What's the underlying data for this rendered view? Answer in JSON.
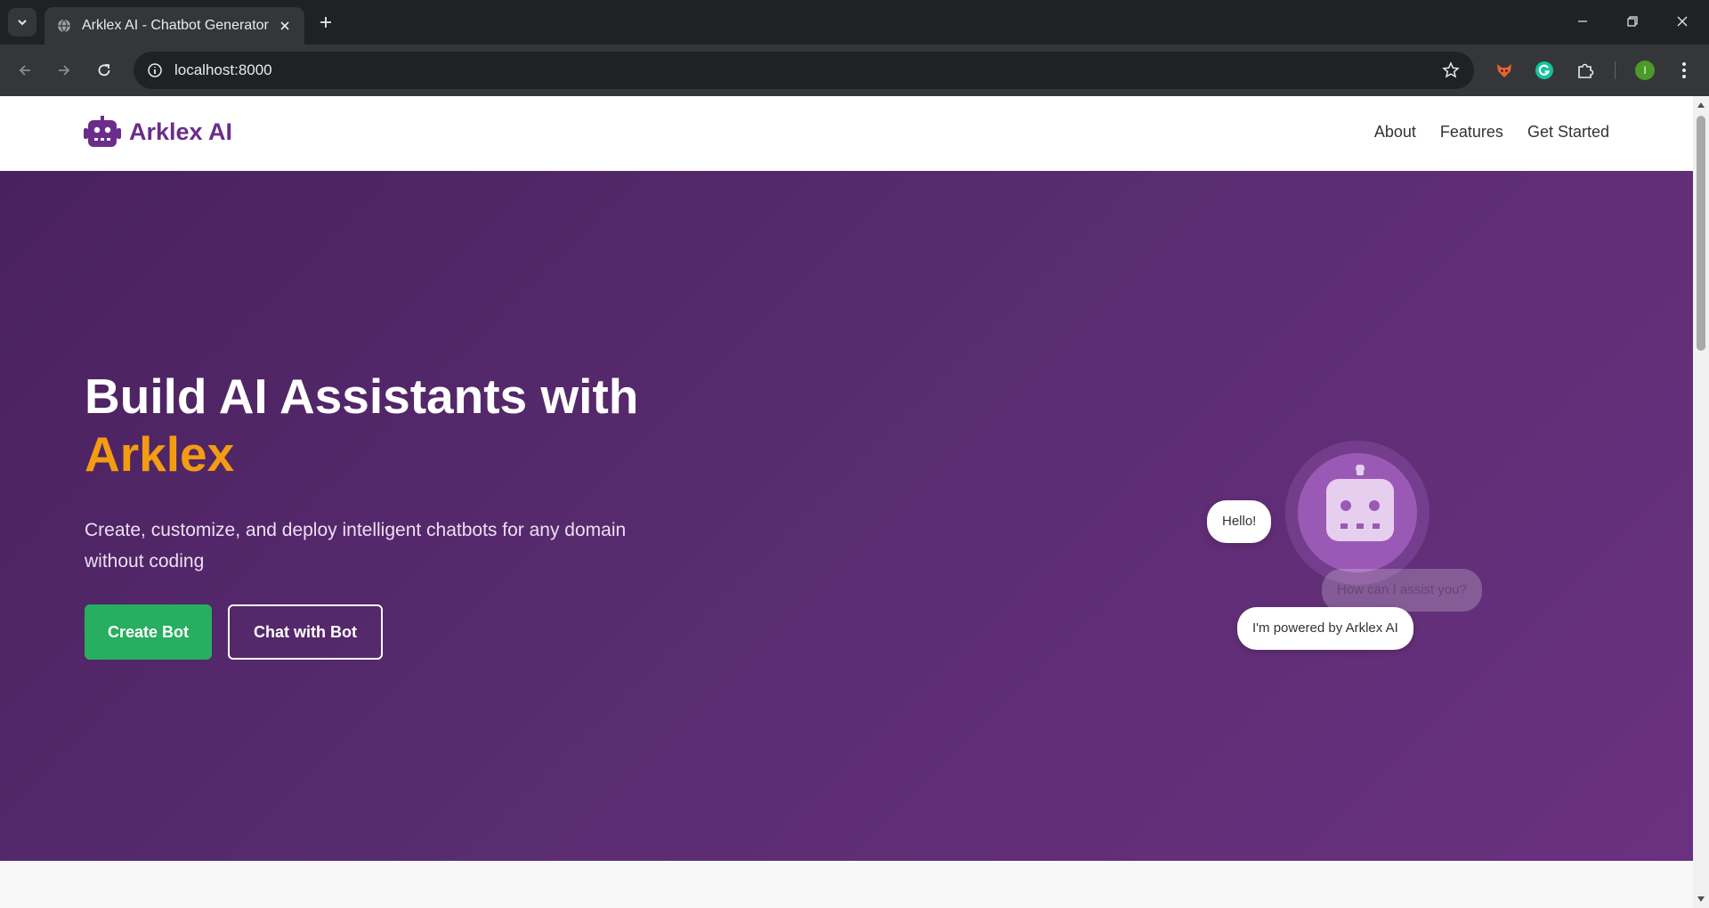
{
  "browser": {
    "tab_title": "Arklex AI - Chatbot Generator",
    "url": "localhost:8000",
    "profile_initial": "I",
    "icons": {
      "tab_menu": "chevron-down-icon",
      "favicon": "globe-icon",
      "tab_close": "close-icon",
      "new_tab": "plus-icon",
      "back": "arrow-left-icon",
      "forward": "arrow-right-icon",
      "reload": "reload-icon",
      "site_info": "info-icon",
      "bookmark": "star-icon",
      "extensions": "puzzle-icon",
      "menu": "kebab-menu-icon"
    }
  },
  "site": {
    "brand": "Arklex AI",
    "brand_icon": "robot-icon",
    "nav": [
      "About",
      "Features",
      "Get Started"
    ]
  },
  "hero": {
    "title_line1": "Build AI Assistants with",
    "title_accent": "Arklex",
    "subtitle": "Create, customize, and deploy intelligent chatbots for any domain without coding",
    "primary_button": "Create Bot",
    "secondary_button": "Chat with Bot"
  },
  "bot_graphic": {
    "bubbles": [
      "Hello!",
      "How can I assist you?",
      "I'm powered by Arklex AI"
    ]
  },
  "colors": {
    "brand_purple": "#6b2d8b",
    "accent_orange": "#f39c12",
    "primary_green": "#27ae60",
    "hero_gradient_start": "#4a2160",
    "hero_gradient_end": "#6a3180"
  }
}
